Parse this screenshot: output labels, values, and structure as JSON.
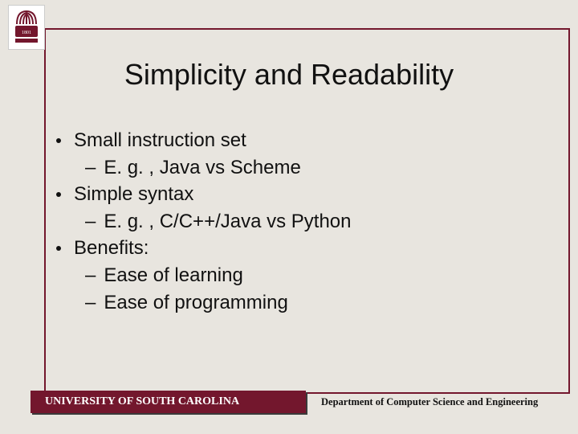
{
  "title": "Simplicity and Readability",
  "bullets": [
    {
      "level": 1,
      "text": "Small instruction set"
    },
    {
      "level": 2,
      "text": "E. g. , Java vs Scheme"
    },
    {
      "level": 1,
      "text": "Simple syntax"
    },
    {
      "level": 2,
      "text": "E. g. , C/C++/Java vs Python"
    },
    {
      "level": 1,
      "text": "Benefits:"
    },
    {
      "level": 2,
      "text": "Ease of learning"
    },
    {
      "level": 2,
      "text": "Ease of programming"
    }
  ],
  "footer": {
    "university": "UNIVERSITY OF SOUTH CAROLINA",
    "department": "Department of Computer Science and Engineering"
  },
  "colors": {
    "garnet": "#73172d",
    "background": "#e8e5df"
  }
}
